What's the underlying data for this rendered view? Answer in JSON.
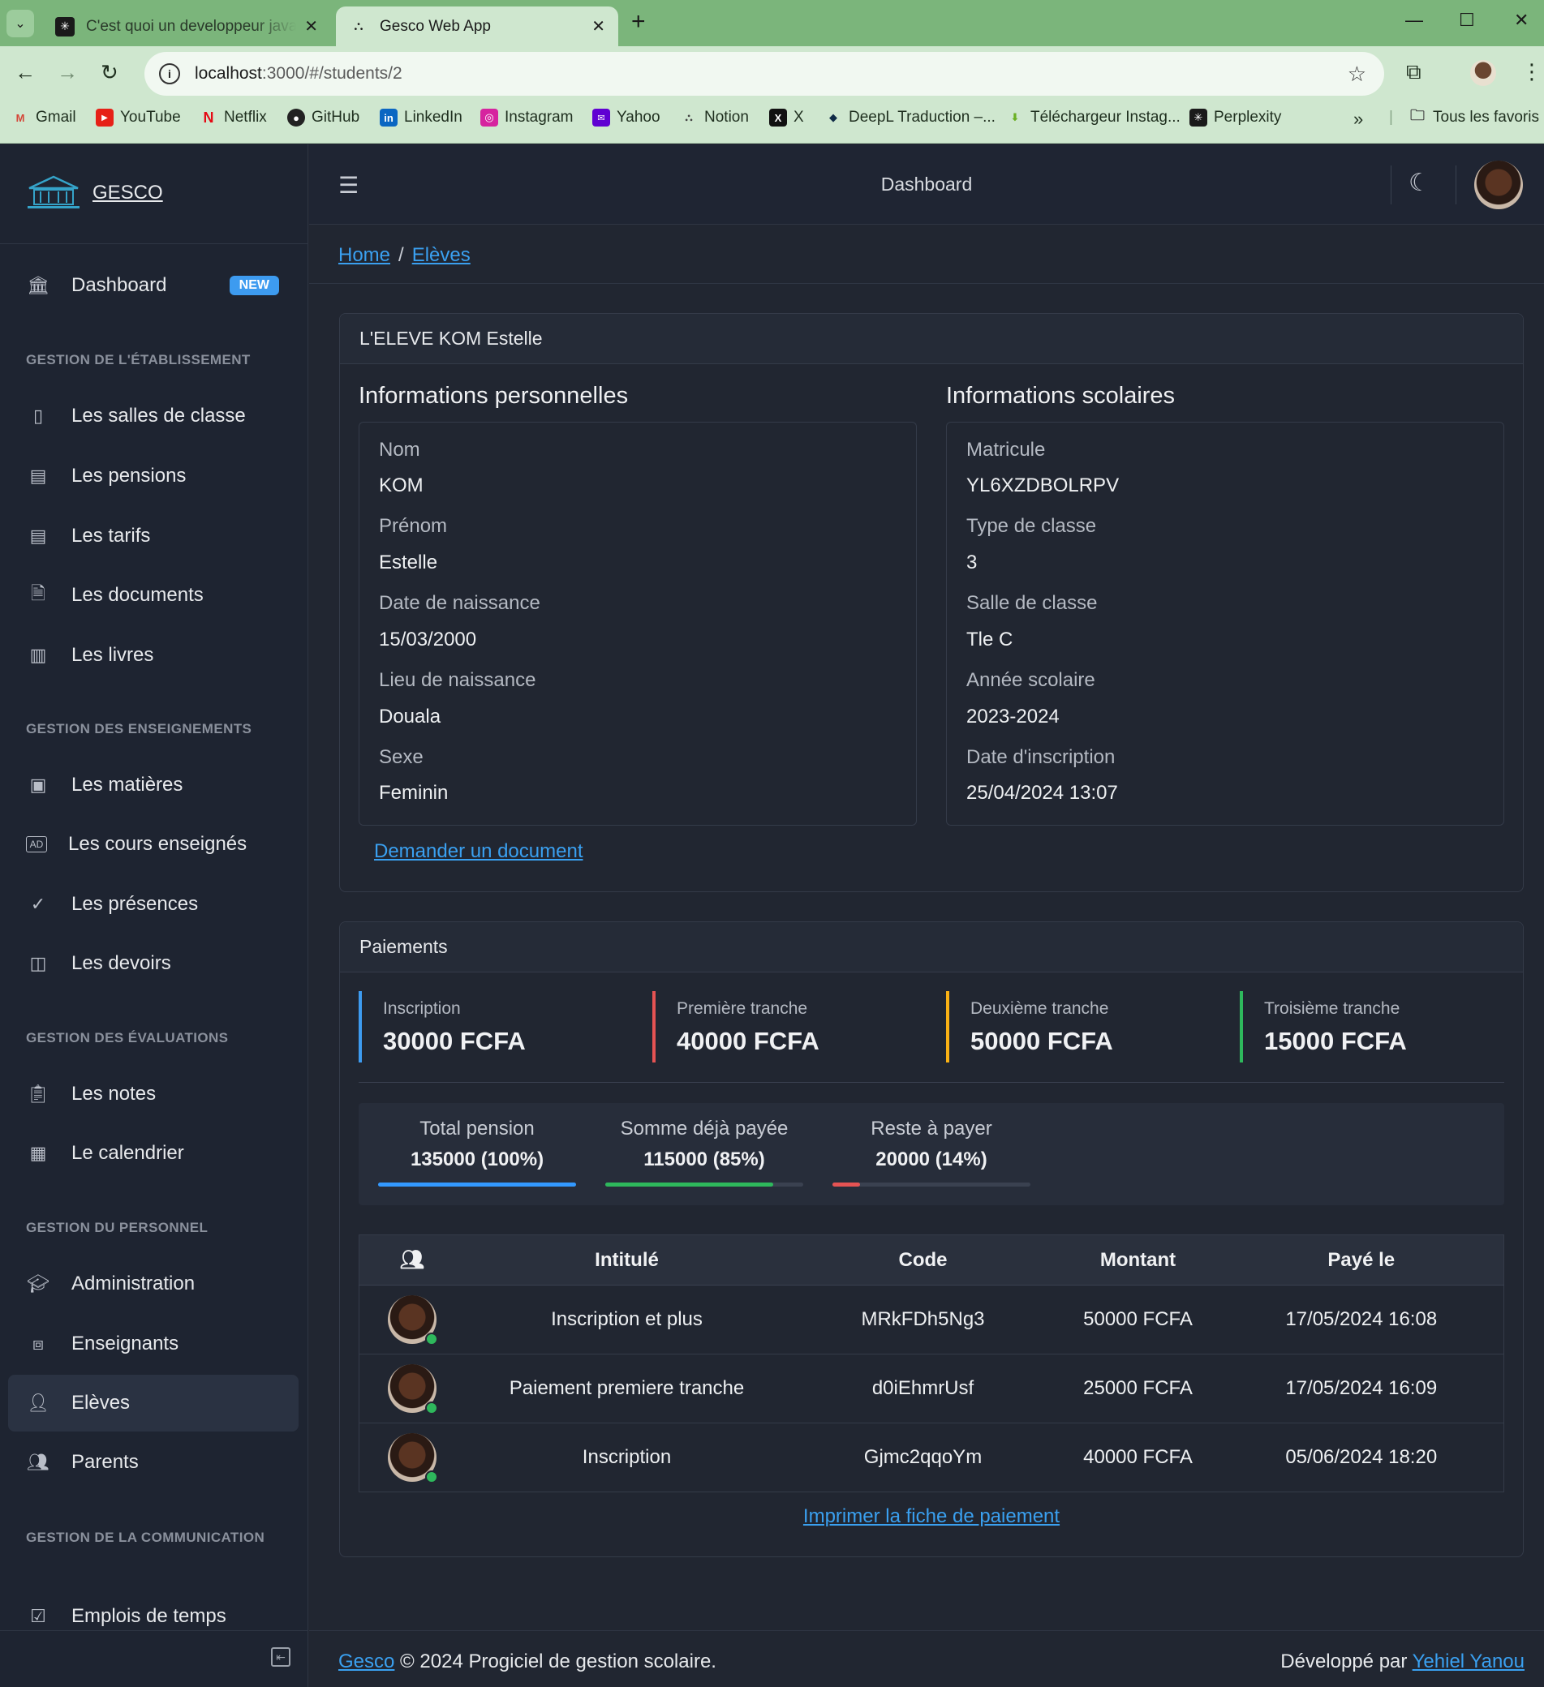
{
  "browser": {
    "tabs": [
      {
        "title": "C'est quoi un developpeur java",
        "active": false
      },
      {
        "title": "Gesco Web App",
        "active": true
      }
    ],
    "url_host": "localhost",
    "url_path": ":3000/#/students/2",
    "bookmarks": [
      {
        "label": "Gmail",
        "icon": "gmail-icon"
      },
      {
        "label": "YouTube",
        "icon": "youtube-icon"
      },
      {
        "label": "Netflix",
        "icon": "netflix-icon"
      },
      {
        "label": "GitHub",
        "icon": "github-icon"
      },
      {
        "label": "LinkedIn",
        "icon": "linkedin-icon"
      },
      {
        "label": "Instagram",
        "icon": "instagram-icon"
      },
      {
        "label": "Yahoo",
        "icon": "yahoo-icon"
      },
      {
        "label": "Notion",
        "icon": "notion-icon"
      },
      {
        "label": "X",
        "icon": "x-icon"
      },
      {
        "label": "DeepL Traduction –...",
        "icon": "deepl-icon"
      },
      {
        "label": "Téléchargeur Instag...",
        "icon": "downloader-icon"
      },
      {
        "label": "Perplexity",
        "icon": "perplexity-icon"
      }
    ],
    "all_bookmarks": "Tous les favoris"
  },
  "sidebar": {
    "brand": "GESCO",
    "dashboard": {
      "label": "Dashboard",
      "badge": "NEW"
    },
    "sections": [
      {
        "title": "GESTION DE L'ÉTABLISSEMENT",
        "items": [
          "Les salles de classe",
          "Les pensions",
          "Les tarifs",
          "Les documents",
          "Les livres"
        ]
      },
      {
        "title": "GESTION DES ENSEIGNEMENTS",
        "items": [
          "Les matières",
          "Les cours enseignés",
          "Les présences",
          "Les devoirs"
        ]
      },
      {
        "title": "GESTION DES ÉVALUATIONS",
        "items": [
          "Les notes",
          "Le calendrier"
        ]
      },
      {
        "title": "GESTION DU PERSONNEL",
        "items": [
          "Administration",
          "Enseignants",
          "Elèves",
          "Parents"
        ]
      },
      {
        "title": "GESTION DE LA COMMUNICATION",
        "items": [
          "Emplois de temps"
        ]
      }
    ],
    "active_item": "Elèves"
  },
  "header": {
    "title": "Dashboard"
  },
  "breadcrumb": {
    "home": "Home",
    "current": "Elèves"
  },
  "student_card": {
    "title": "L'ELEVE KOM Estelle",
    "personal_title": "Informations personnelles",
    "personal": [
      {
        "label": "Nom",
        "value": "KOM"
      },
      {
        "label": "Prénom",
        "value": "Estelle"
      },
      {
        "label": "Date de naissance",
        "value": "15/03/2000"
      },
      {
        "label": "Lieu de naissance",
        "value": "Douala"
      },
      {
        "label": "Sexe",
        "value": "Feminin"
      }
    ],
    "school_title": "Informations scolaires",
    "school": [
      {
        "label": "Matricule",
        "value": "YL6XZDBOLRPV"
      },
      {
        "label": "Type de classe",
        "value": "3"
      },
      {
        "label": "Salle de classe",
        "value": "Tle C"
      },
      {
        "label": "Année scolaire",
        "value": "2023-2024"
      },
      {
        "label": "Date d'inscription",
        "value": "25/04/2024 13:07"
      }
    ],
    "request_link": "Demander un document"
  },
  "payments": {
    "title": "Paiements",
    "stats": [
      {
        "label": "Inscription",
        "value": "30000 FCFA",
        "color": "#3d9bf0"
      },
      {
        "label": "Première tranche",
        "value": "40000 FCFA",
        "color": "#e55353"
      },
      {
        "label": "Deuxième tranche",
        "value": "50000 FCFA",
        "color": "#f9b115"
      },
      {
        "label": "Troisième tranche",
        "value": "15000 FCFA",
        "color": "#2eb85c"
      }
    ],
    "summary": [
      {
        "label": "Total pension",
        "value": "135000 (100%)",
        "percent": 100,
        "color": "#3399ff"
      },
      {
        "label": "Somme déjà payée",
        "value": "115000 (85%)",
        "percent": 85,
        "color": "#2eb85c"
      },
      {
        "label": "Reste à payer",
        "value": "20000 (14%)",
        "percent": 14,
        "color": "#e55353"
      }
    ],
    "columns": [
      "Intitulé",
      "Code",
      "Montant",
      "Payé le"
    ],
    "rows": [
      {
        "title": "Inscription et plus",
        "code": "MRkFDh5Ng3",
        "amount": "50000 FCFA",
        "date": "17/05/2024 16:08"
      },
      {
        "title": "Paiement premiere tranche",
        "code": "d0iEhmrUsf",
        "amount": "25000 FCFA",
        "date": "17/05/2024 16:09"
      },
      {
        "title": "Inscription",
        "code": "Gjmc2qqoYm",
        "amount": "40000 FCFA",
        "date": "05/06/2024 18:20"
      }
    ],
    "print_link": "Imprimer la fiche de paiement"
  },
  "footer": {
    "brand_link": "Gesco",
    "copyright": "© 2024 Progiciel de gestion scolaire.",
    "dev_prefix": "Développé par",
    "dev_link": "Yehiel Yanou"
  }
}
